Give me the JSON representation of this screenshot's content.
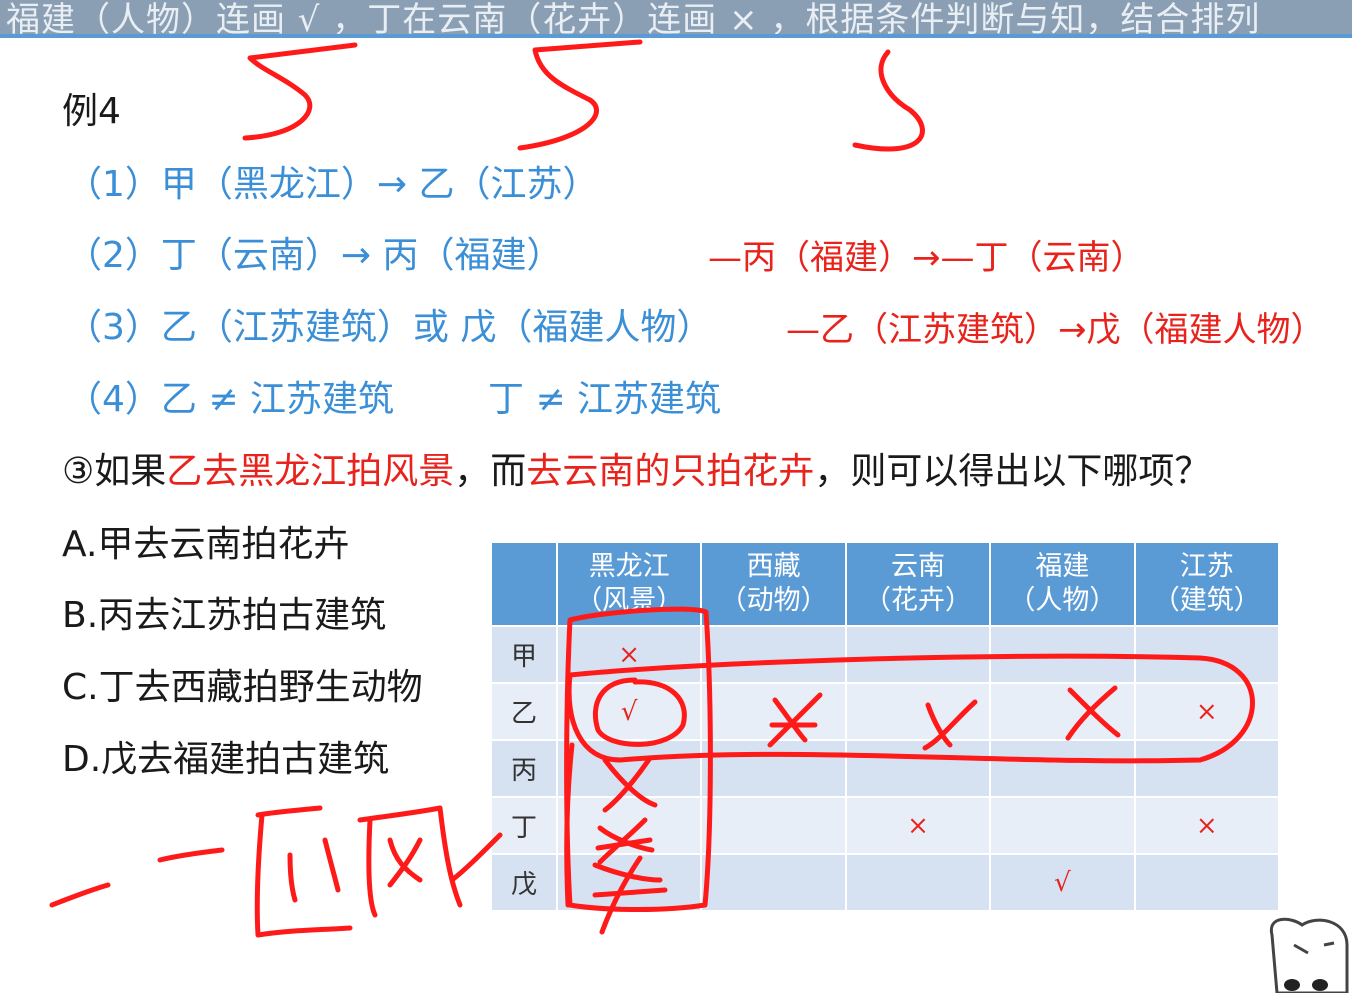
{
  "topbar": {
    "text": "福建（人物）连画 √ ，丁在云南（花卉）连画 × ，根据条件判断与知，结合排列"
  },
  "example": {
    "title": "例4"
  },
  "conditions": [
    {
      "text": "（1）甲（黑龙江）→ 乙（江苏）",
      "note": ""
    },
    {
      "text": "（2）丁（云南）→ 丙（福建）",
      "note": "—丙（福建）→—丁（云南）"
    },
    {
      "text": "（3）乙（江苏建筑）或 戊（福建人物）",
      "note": "—乙（江苏建筑）→戊（福建人物）"
    },
    {
      "text": "（4）乙 ≠ 江苏建筑",
      "text2": "丁 ≠ 江苏建筑"
    }
  ],
  "question": {
    "prefix": "③如果",
    "part1": "乙去黑龙江拍风景",
    "mid": "，而",
    "part2": "去云南的只拍花卉",
    "suffix": "，则可以得出以下哪项？"
  },
  "options": [
    {
      "label": "A.甲去云南拍花卉"
    },
    {
      "label": "B.丙去江苏拍古建筑"
    },
    {
      "label": "C.丁去西藏拍野生动物"
    },
    {
      "label": "D.戊去福建拍古建筑"
    }
  ],
  "table": {
    "headers": [
      {
        "l1": "黑龙江",
        "l2": "（风景）"
      },
      {
        "l1": "西藏",
        "l2": "（动物）"
      },
      {
        "l1": "云南",
        "l2": "（花卉）"
      },
      {
        "l1": "福建",
        "l2": "（人物）"
      },
      {
        "l1": "江苏",
        "l2": "（建筑）"
      }
    ],
    "rows": [
      {
        "name": "甲",
        "cells": [
          "×",
          "",
          "",
          "",
          ""
        ]
      },
      {
        "name": "乙",
        "cells": [
          "√",
          "",
          "",
          "",
          "×"
        ]
      },
      {
        "name": "丙",
        "cells": [
          "",
          "",
          "",
          "",
          ""
        ]
      },
      {
        "name": "丁",
        "cells": [
          "",
          "",
          "×",
          "",
          "×"
        ]
      },
      {
        "name": "戊",
        "cells": [
          "",
          "",
          "",
          "√",
          ""
        ]
      }
    ]
  },
  "colors": {
    "accent_blue": "#3b8fd6",
    "header_blue": "#5b9bd5",
    "mark_red": "#e8231c"
  }
}
